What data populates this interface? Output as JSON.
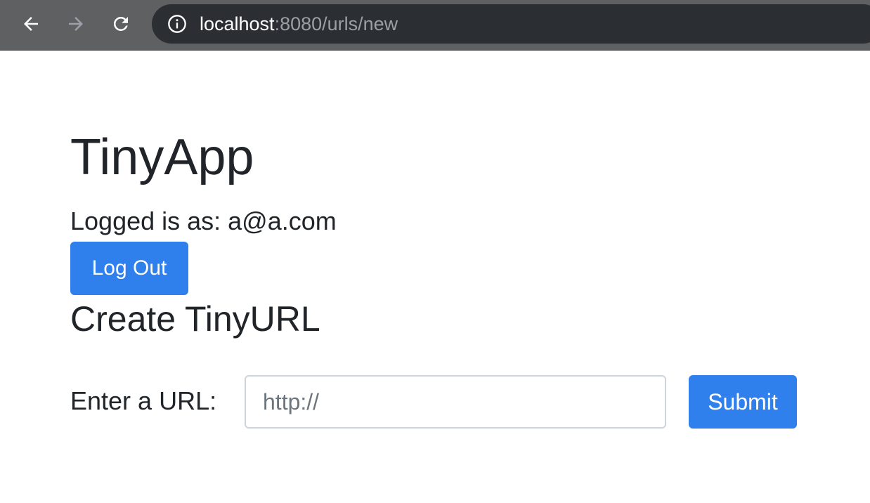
{
  "browser": {
    "url_host": "localhost",
    "url_rest": ":8080/urls/new",
    "icons": {
      "back": "arrow-left-icon",
      "forward": "arrow-right-icon",
      "reload": "reload-icon",
      "info": "info-icon"
    }
  },
  "page": {
    "title": "TinyApp",
    "logged_in_text": "Logged is as: a@a.com",
    "logout_label": "Log Out",
    "section_title": "Create TinyURL",
    "url_label": "Enter a URL:",
    "url_placeholder": "http://",
    "submit_label": "Submit"
  },
  "colors": {
    "primary": "#2f80ed",
    "text": "#212529",
    "chrome": "#5f6062",
    "omnibox": "#2b2e33"
  }
}
